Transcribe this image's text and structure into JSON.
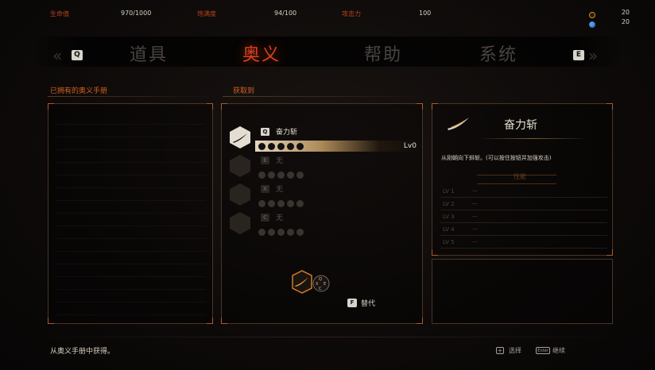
{
  "stats": {
    "hp_label": "生命值",
    "hp_value": "970/1000",
    "satiety_label": "饱满度",
    "satiety_value": "94/100",
    "attack_label": "攻击力",
    "attack_value": "100"
  },
  "resources": {
    "gold": "20",
    "gems": "20"
  },
  "tabs": {
    "prev_key": "Q",
    "next_key": "E",
    "items": [
      {
        "label": "道具"
      },
      {
        "label": "奥义"
      },
      {
        "label": "帮助"
      },
      {
        "label": "系统"
      }
    ],
    "active_index": 1
  },
  "owned_section": {
    "title": "已拥有的奥义手册"
  },
  "acquired_section": {
    "title": "获取到",
    "slots": [
      {
        "key": "Q",
        "name": "奋力斩",
        "level": "Lv0",
        "active": true
      },
      {
        "key": "E",
        "name": "无"
      },
      {
        "key": "X",
        "name": "无"
      },
      {
        "key": "C",
        "name": "无"
      }
    ],
    "alt_key": "F",
    "alt_label": "替代",
    "wheel_keys": [
      "Q",
      "E",
      "X",
      "C"
    ]
  },
  "detail": {
    "name": "奋力斩",
    "description": "从刚朝向下斜斩。(可以按住按钮并加强攻击)",
    "traits_title": "性能",
    "levels": [
      {
        "label": "LV 1",
        "value": "—"
      },
      {
        "label": "LV 2",
        "value": "—"
      },
      {
        "label": "LV 3",
        "value": "—"
      },
      {
        "label": "LV 4",
        "value": "—"
      },
      {
        "label": "LV 5",
        "value": "—"
      }
    ]
  },
  "footer": {
    "source_text": "从奥义手册中获得。",
    "select_label": "选择",
    "continue_icon_text": "Enter",
    "continue_label": "继续"
  },
  "colors": {
    "accent": "#e0401c",
    "label_red": "#b8401e",
    "section_orange": "#d0621e"
  }
}
